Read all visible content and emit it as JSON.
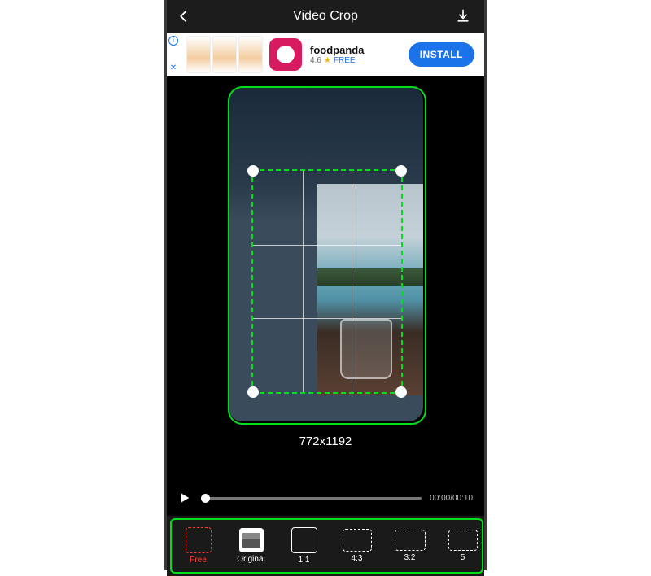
{
  "header": {
    "title": "Video Crop"
  },
  "ad": {
    "name": "foodpanda",
    "rating": "4.6",
    "price": "FREE",
    "button": "INSTALL"
  },
  "crop": {
    "dimensions": "772x1192"
  },
  "player": {
    "time": "00:00/00:10"
  },
  "ratios": {
    "free": "Free",
    "original": "Original",
    "r11": "1:1",
    "r43": "4:3",
    "r32": "3:2",
    "r5": "5"
  }
}
